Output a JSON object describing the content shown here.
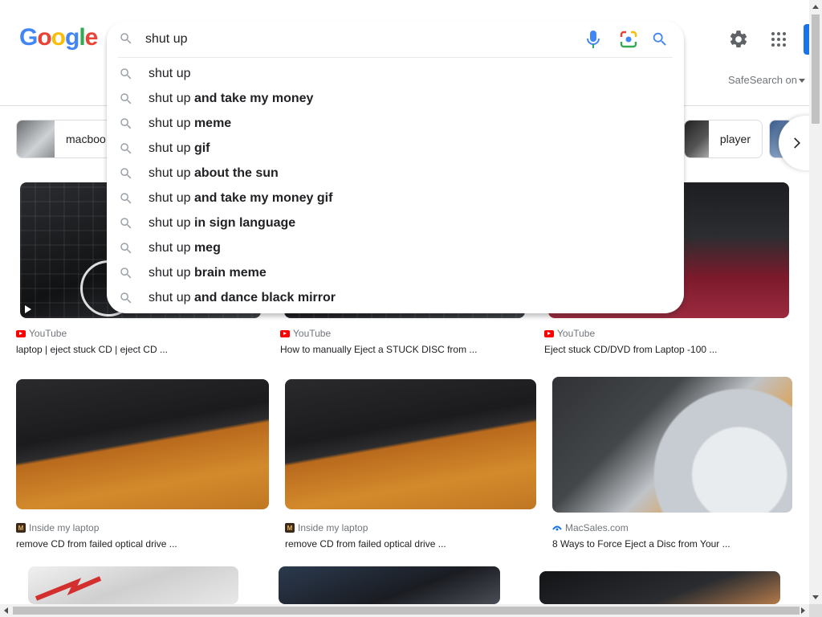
{
  "header": {
    "logo_letters": [
      {
        "ch": "G",
        "color": "#4285f4"
      },
      {
        "ch": "o",
        "color": "#ea4335"
      },
      {
        "ch": "o",
        "color": "#fbbc05"
      },
      {
        "ch": "g",
        "color": "#4285f4"
      },
      {
        "ch": "l",
        "color": "#34a853"
      },
      {
        "ch": "e",
        "color": "#ea4335"
      }
    ],
    "safesearch_label": "SafeSearch on"
  },
  "search": {
    "query": "shut up",
    "suggestions": [
      {
        "prefix": "shut up",
        "bold": ""
      },
      {
        "prefix": "shut up ",
        "bold": "and take my money"
      },
      {
        "prefix": "shut up ",
        "bold": "meme"
      },
      {
        "prefix": "shut up ",
        "bold": "gif"
      },
      {
        "prefix": "shut up ",
        "bold": "about the sun"
      },
      {
        "prefix": "shut up ",
        "bold": "and take my money gif"
      },
      {
        "prefix": "shut up ",
        "bold": "in sign language"
      },
      {
        "prefix": "shut up ",
        "bold": "meg"
      },
      {
        "prefix": "shut up ",
        "bold": "brain meme"
      },
      {
        "prefix": "shut up ",
        "bold": "and dance black mirror"
      }
    ]
  },
  "chips": {
    "left_label": "macboo",
    "right_label": "player"
  },
  "results": [
    {
      "source": "YouTube",
      "title": "laptop | eject stuck CD | eject CD ..."
    },
    {
      "source": "YouTube",
      "title": "How to manually Eject a STUCK DISC from ..."
    },
    {
      "source": "YouTube",
      "title": "Eject stuck CD/DVD from Laptop -100 ..."
    },
    {
      "source": "Inside my laptop",
      "title": "remove CD from failed optical drive ..."
    },
    {
      "source": "Inside my laptop",
      "title": "remove CD from failed optical drive ..."
    },
    {
      "source": "MacSales.com",
      "title": "8 Ways to Force Eject a Disc from Your ..."
    }
  ],
  "colors": {
    "youtube": "#ff0000",
    "accent_blue": "#1a73e8"
  }
}
